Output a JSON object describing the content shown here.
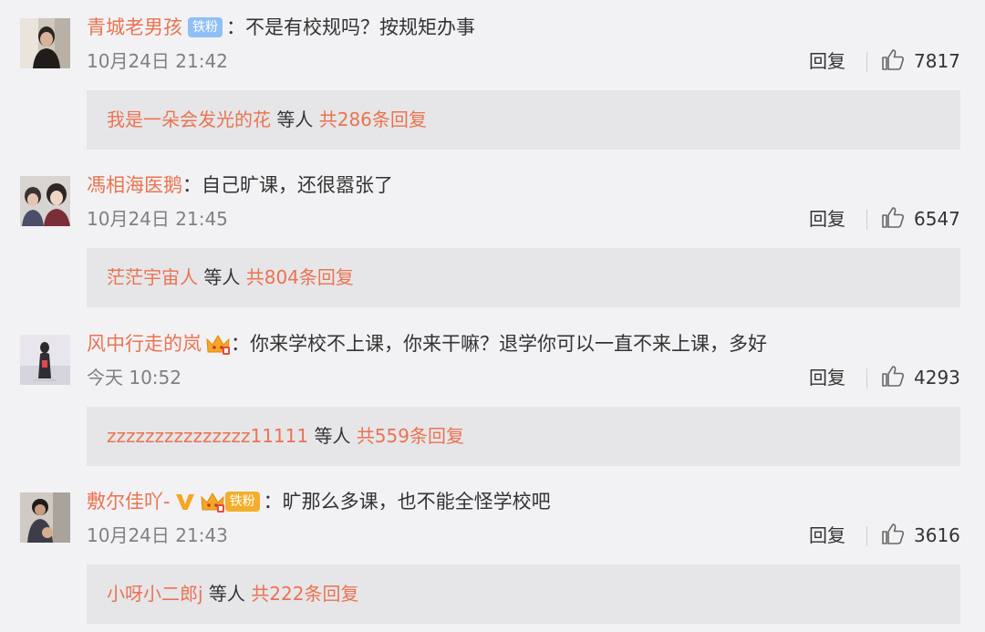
{
  "comments": [
    {
      "username": "青城老男孩",
      "badge": "铁粉",
      "colon": "：",
      "content": "不是有校规吗？按规矩办事",
      "time": "10月24日 21:42",
      "reply_label": "回复",
      "likes": "7817",
      "reply_user": "我是一朵会发光的花",
      "reply_mid": " 等人 ",
      "reply_total": "共286条回复"
    },
    {
      "username": "馮相海医鹅",
      "colon": "：",
      "content": "自己旷课，还很嚣张了",
      "time": "10月24日 21:45",
      "reply_label": "回复",
      "likes": "6547",
      "reply_user": "茫茫宇宙人",
      "reply_mid": " 等人 ",
      "reply_total": "共804条回复"
    },
    {
      "username": "风中行走的岚",
      "colon": "：",
      "content": "你来学校不上课，你来干嘛？退学你可以一直不来上课，多好",
      "time": "今天 10:52",
      "reply_label": "回复",
      "likes": "4293",
      "reply_user": "zzzzzzzzzzzzzzz11111",
      "reply_mid": " 等人 ",
      "reply_total": "共559条回复"
    },
    {
      "username": "敷尔佳吖-",
      "badge": "铁粉",
      "colon": "：",
      "content": "旷那么多课，也不能全怪学校吧",
      "time": "10月24日 21:43",
      "reply_label": "回复",
      "likes": "3616",
      "reply_user": "小呀小二郎j",
      "reply_mid": " 等人 ",
      "reply_total": "共222条回复"
    }
  ],
  "colors": {
    "background": "#f2f2f5",
    "username": "#eb7350",
    "reply_box": "#e6e6e9",
    "badge_blue": "#8fc0f5",
    "badge_orange": "#f3ae2c",
    "verify_gold": "#f5a623",
    "meta_gray": "#808080"
  },
  "icons": {
    "like": "thumbs-up-icon",
    "vip": "vip-crown-icon",
    "verify": "verified-v-icon"
  }
}
